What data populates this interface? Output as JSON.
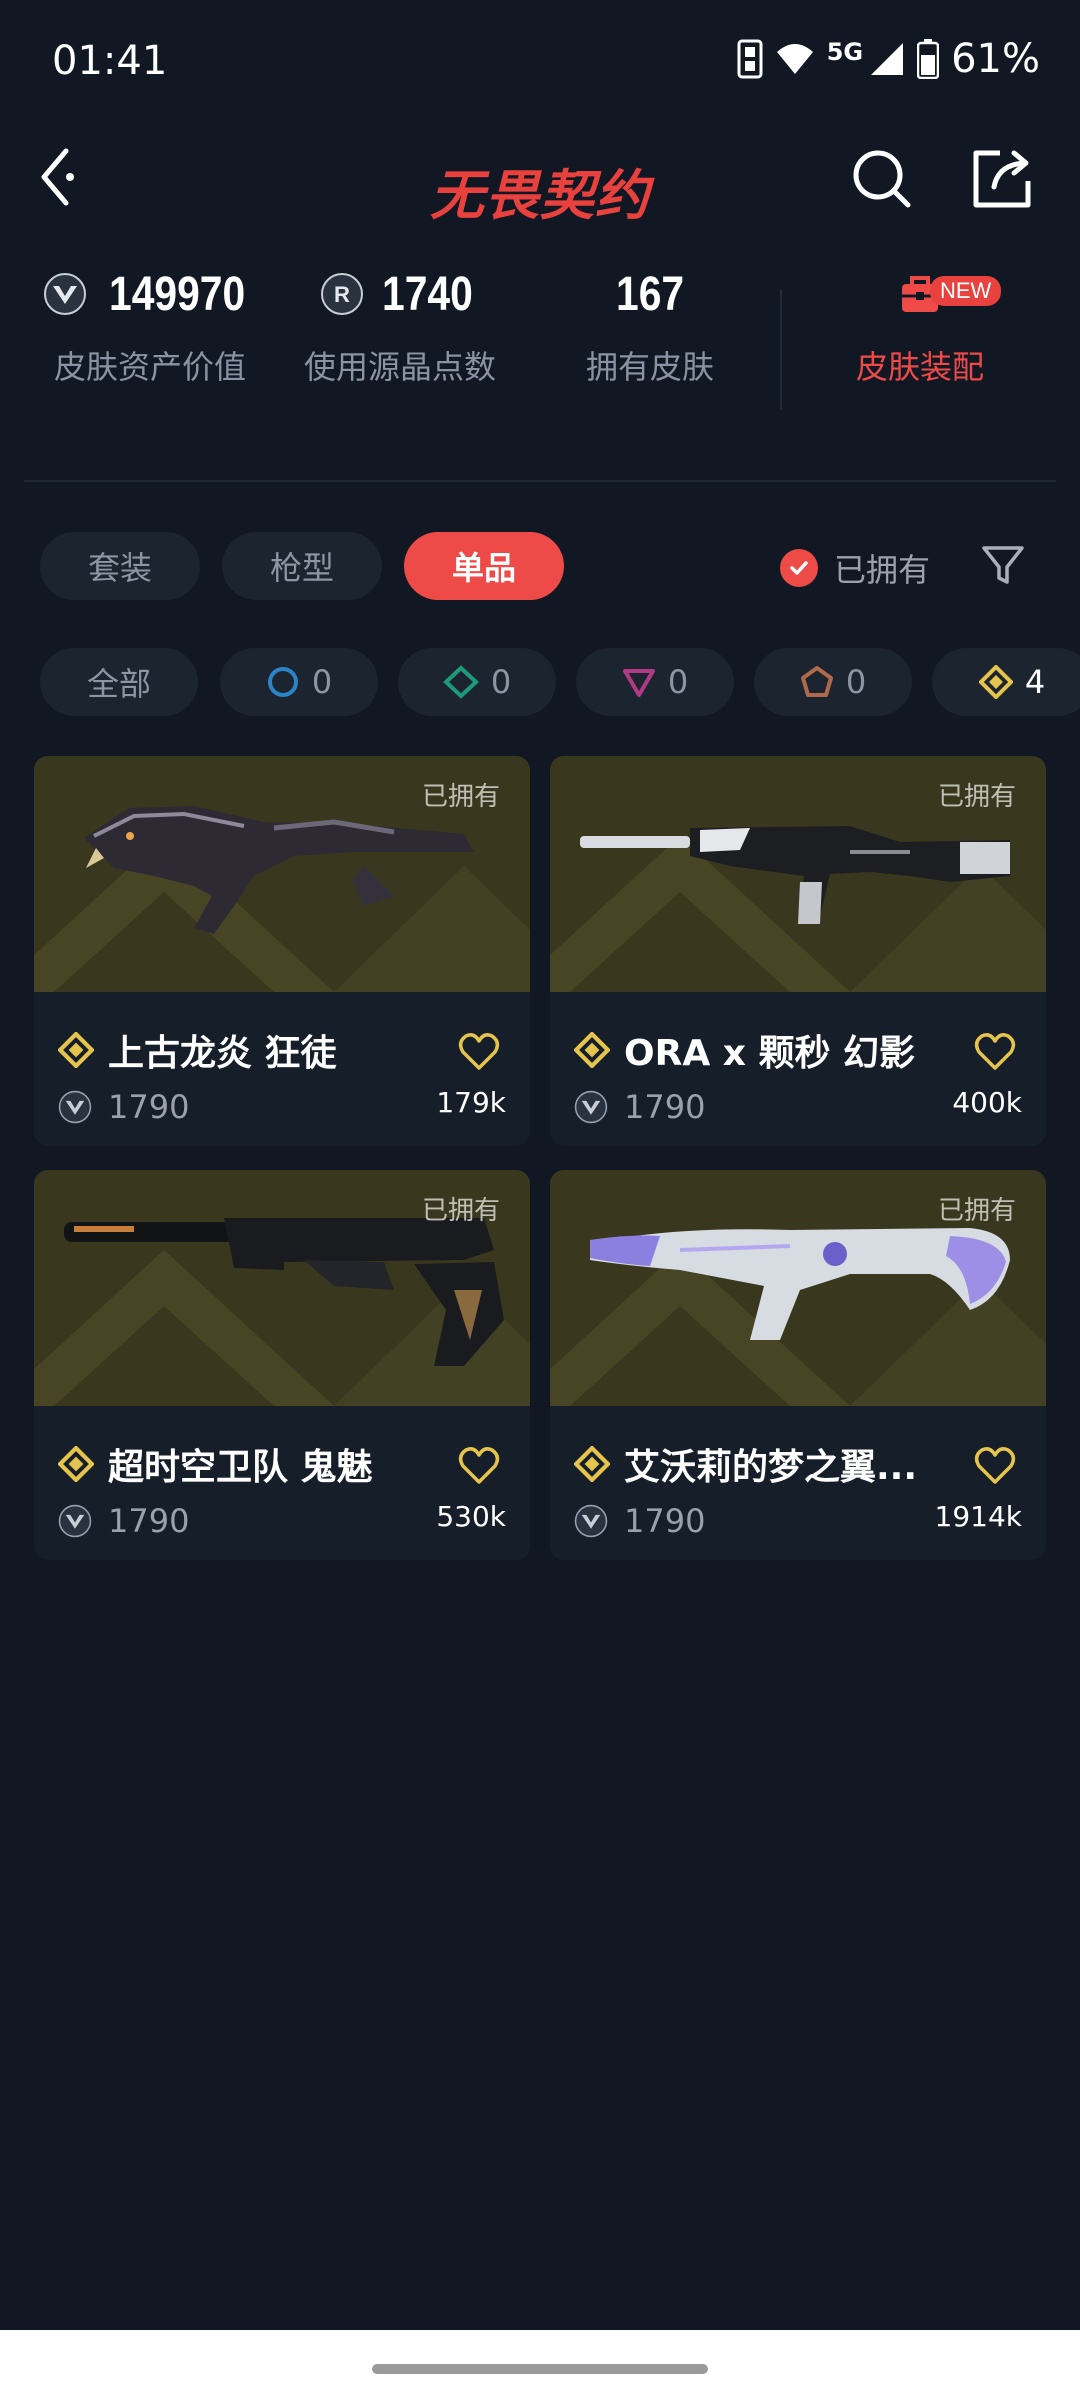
{
  "status": {
    "time": "01:41",
    "network": "5G",
    "battery": "61%"
  },
  "header": {
    "title": "无畏契约"
  },
  "stats": {
    "asset_value": "149970",
    "asset_value_label": "皮肤资产价值",
    "radianite": "1740",
    "radianite_label": "使用源晶点数",
    "skins_owned": "167",
    "skins_owned_label": "拥有皮肤",
    "outfit_label": "皮肤装配",
    "new_badge": "NEW"
  },
  "tabs": [
    {
      "label": "套装",
      "active": false
    },
    {
      "label": "枪型",
      "active": false
    },
    {
      "label": "单品",
      "active": true
    }
  ],
  "owned_filter_label": "已拥有",
  "tiers": [
    {
      "label": "全部",
      "icon": "all"
    },
    {
      "count": "0",
      "icon": "select-tier-icon",
      "color": "#2a84c8"
    },
    {
      "count": "0",
      "icon": "deluxe-tier-icon",
      "color": "#1f9a78"
    },
    {
      "count": "0",
      "icon": "premium-tier-icon",
      "color": "#b13a85"
    },
    {
      "count": "0",
      "icon": "ultra-tier-icon",
      "color": "#b06a4a"
    },
    {
      "count": "4",
      "icon": "exclusive-tier-icon",
      "color": "#e5c44d"
    }
  ],
  "cards": [
    {
      "owned": "已拥有",
      "title": "上古龙炎 狂徒",
      "price": "1790",
      "favorites": "179k"
    },
    {
      "owned": "已拥有",
      "title": "ORA x 颗秒 幻影",
      "price": "1790",
      "favorites": "400k"
    },
    {
      "owned": "已拥有",
      "title": "超时空卫队 鬼魅",
      "price": "1790",
      "favorites": "530k"
    },
    {
      "owned": "已拥有",
      "title": "艾沃莉的梦之翼...",
      "price": "1790",
      "favorites": "1914k"
    }
  ],
  "colors": {
    "background": "#111823",
    "accent": "#ee4b48",
    "card": "#161e2a",
    "exclusive_gold": "#e5c44d"
  }
}
